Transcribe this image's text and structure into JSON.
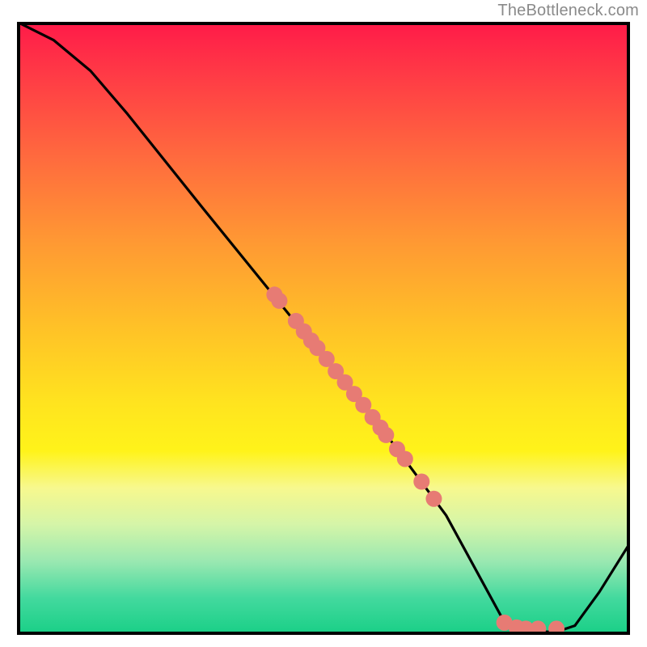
{
  "watermark": "TheBottleneck.com",
  "chart_data": {
    "type": "line",
    "title": "",
    "xlabel": "",
    "ylabel": "",
    "xlim": [
      0,
      100
    ],
    "ylim": [
      0,
      100
    ],
    "grid": false,
    "legend": false,
    "series": [
      {
        "name": "bottleneck-curve",
        "color": "#000000",
        "points": [
          {
            "x": 0.0,
            "y": 100.0
          },
          {
            "x": 6.0,
            "y": 97.0
          },
          {
            "x": 12.0,
            "y": 92.0
          },
          {
            "x": 18.0,
            "y": 85.0
          },
          {
            "x": 30.0,
            "y": 70.0
          },
          {
            "x": 45.0,
            "y": 51.5
          },
          {
            "x": 60.0,
            "y": 33.0
          },
          {
            "x": 70.0,
            "y": 19.5
          },
          {
            "x": 76.0,
            "y": 8.5
          },
          {
            "x": 79.0,
            "y": 3.0
          },
          {
            "x": 81.5,
            "y": 0.5
          },
          {
            "x": 88.0,
            "y": 0.5
          },
          {
            "x": 91.0,
            "y": 1.5
          },
          {
            "x": 95.0,
            "y": 7.0
          },
          {
            "x": 100.0,
            "y": 15.0
          }
        ]
      }
    ],
    "scatter": {
      "name": "sample-points",
      "color": "#e77b74",
      "radius": 10,
      "points": [
        {
          "x": 42.0,
          "y": 55.5
        },
        {
          "x": 42.8,
          "y": 54.5
        },
        {
          "x": 45.5,
          "y": 51.2
        },
        {
          "x": 46.8,
          "y": 49.5
        },
        {
          "x": 48.0,
          "y": 48.0
        },
        {
          "x": 49.0,
          "y": 46.8
        },
        {
          "x": 50.5,
          "y": 45.0
        },
        {
          "x": 52.0,
          "y": 43.0
        },
        {
          "x": 53.5,
          "y": 41.2
        },
        {
          "x": 55.0,
          "y": 39.3
        },
        {
          "x": 56.5,
          "y": 37.5
        },
        {
          "x": 58.0,
          "y": 35.5
        },
        {
          "x": 59.3,
          "y": 33.8
        },
        {
          "x": 60.2,
          "y": 32.6
        },
        {
          "x": 62.0,
          "y": 30.3
        },
        {
          "x": 63.3,
          "y": 28.7
        },
        {
          "x": 66.0,
          "y": 25.0
        },
        {
          "x": 68.0,
          "y": 22.2
        },
        {
          "x": 79.5,
          "y": 2.0
        },
        {
          "x": 81.5,
          "y": 1.2
        },
        {
          "x": 83.0,
          "y": 1.0
        },
        {
          "x": 85.0,
          "y": 1.0
        },
        {
          "x": 88.0,
          "y": 1.0
        }
      ]
    },
    "background_gradient": {
      "direction": "vertical",
      "stops": [
        {
          "pos": 0.0,
          "color": "#ff1a49"
        },
        {
          "pos": 0.36,
          "color": "#ff9933"
        },
        {
          "pos": 0.7,
          "color": "#fff31a"
        },
        {
          "pos": 1.0,
          "color": "#18cf86"
        }
      ]
    }
  }
}
